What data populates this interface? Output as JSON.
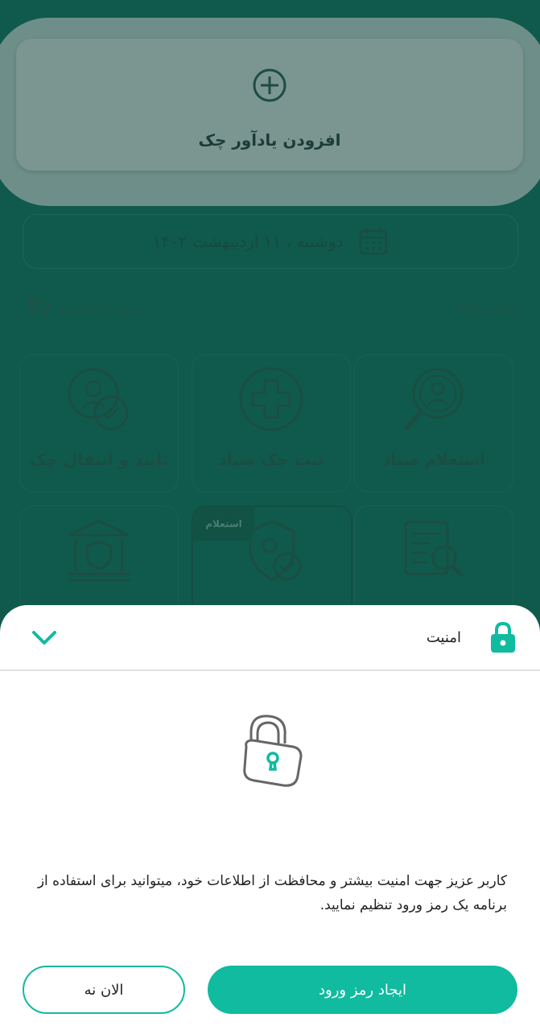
{
  "header": {
    "add_reminder_label": "افزودن یادآور چک"
  },
  "date_bar": {
    "date_text": "دوشنبه ، ۱۱ اردیبهشت ۱۴۰۲"
  },
  "section": {
    "services_title": "خدمات یاد۲۴",
    "custom_menu_label": "منوی اختصاصی"
  },
  "tiles": [
    {
      "label": "استعلام صیاد"
    },
    {
      "label": "ثبت چک صیاد"
    },
    {
      "label": "تایید و انتقال چک"
    },
    {
      "label": ""
    },
    {
      "label": "",
      "badge": "استعلام"
    },
    {
      "label": ""
    }
  ],
  "sheet": {
    "title": "امنیت",
    "message": "کاربر عزیز جهت امنیت بیشتر و محافظت از اطلاعات خود، میتوانید برای استفاده از برنامه یک رمز ورود تنظیم نمایید.",
    "primary_button": "ایجاد رمز ورود",
    "secondary_button": "الان نه"
  },
  "colors": {
    "accent": "#10bb9f",
    "overlay_bg": "#0f5a4c",
    "sheet_bg": "#ffffff"
  },
  "icons": [
    "plus-circle-icon",
    "calendar-icon",
    "custom-menu-icon",
    "search-person-icon",
    "medical-cross-icon",
    "user-check-icon",
    "document-search-icon",
    "user-shield-icon",
    "bank-shield-icon",
    "lock-icon",
    "chevron-down-icon",
    "padlock-illustration-icon"
  ]
}
